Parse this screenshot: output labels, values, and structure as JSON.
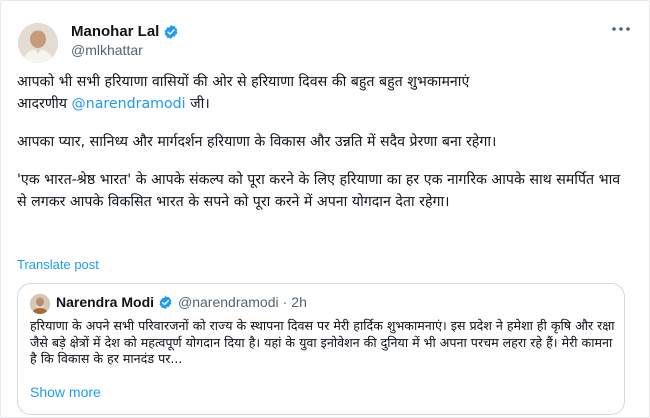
{
  "author": {
    "name": "Manohar Lal",
    "handle": "@mlkhattar"
  },
  "tweet": {
    "line1": "आपको भी सभी हरियाणा वासियों की ओर से हरियाणा दिवस की बहुत बहुत शुभकामनाएं",
    "line2_prefix": "आदरणीय ",
    "mention": "@narendramodi",
    "line2_suffix": " जी।",
    "para2": "आपका प्यार, सानिध्य और मार्गदर्शन हरियाणा के विकास और उन्नति में सदैव प्रेरणा बना रहेगा।",
    "para3": "'एक भारत-श्रेष्ठ भारत' के आपके संकल्प को पूरा करने के लिए हरियाणा का हर एक नागरिक आपके साथ समर्पित भाव से लगकर आपके विकसित भारत के सपने को पूरा करने में अपना योगदान देता रहेगा।"
  },
  "translate_label": "Translate post",
  "quote": {
    "name": "Narendra Modi",
    "handle": "@narendramodi",
    "separator": "·",
    "time": "2h",
    "text": "हरियाणा के अपने सभी परिवारजनों को राज्य के स्थापना दिवस पर मेरी हार्दिक शुभकामनाएं। इस प्रदेश ने हमेशा ही कृषि और रक्षा जैसे बड़े क्षेत्रों में देश को महत्वपूर्ण योगदान दिया है। यहां के युवा इनोवेशन की दुनिया में भी अपना परचम लहरा रहे हैं। मेरी कामना है कि विकास के हर मानदंड पर...",
    "show_more": "Show more"
  },
  "icons": {
    "verified": "verified-badge-icon",
    "more": "more-options-icon"
  },
  "colors": {
    "accent": "#1d9bf0",
    "secondary_text": "#536471",
    "border": "#cfd9de"
  }
}
